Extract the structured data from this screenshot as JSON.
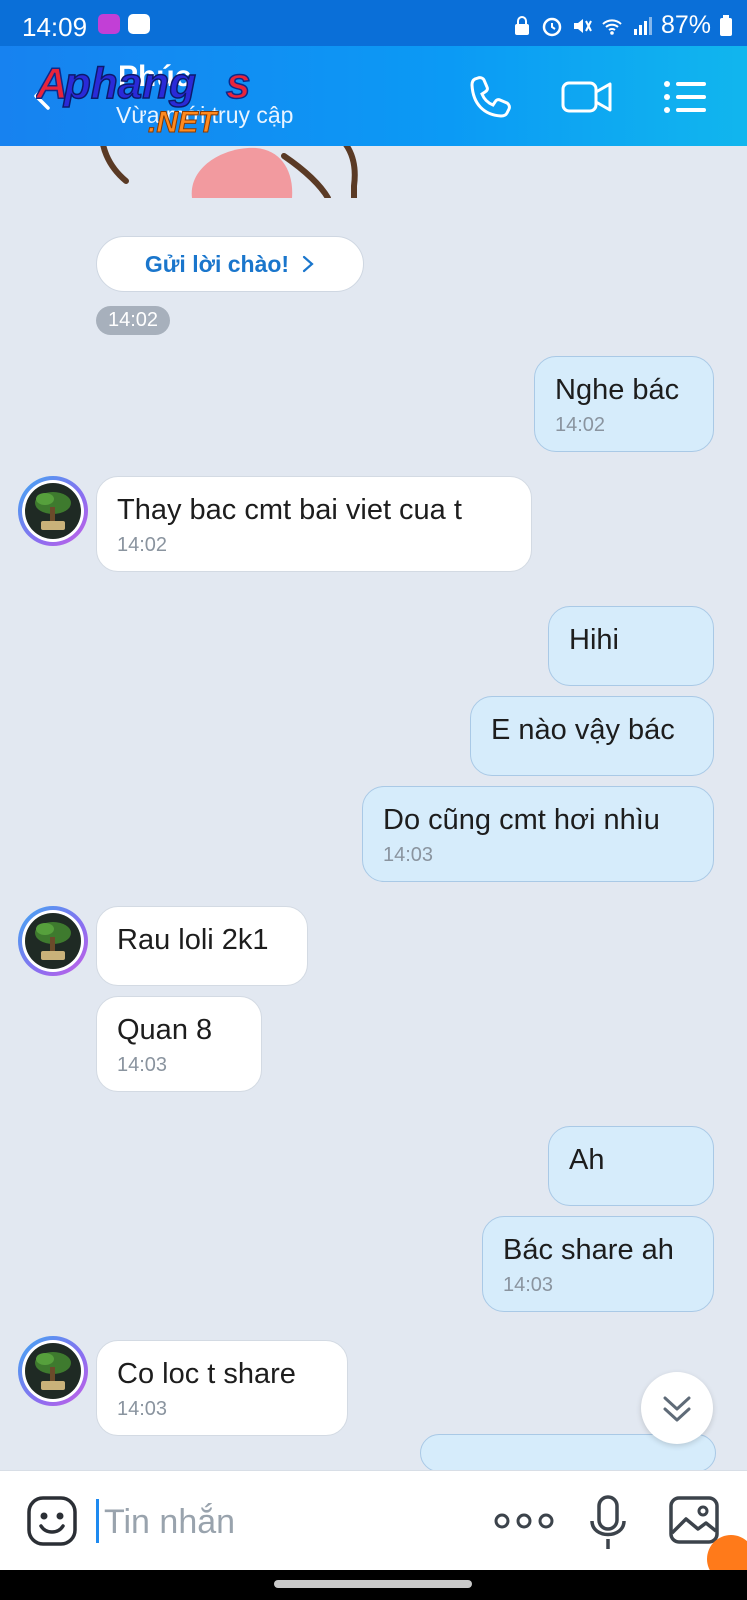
{
  "status_bar": {
    "time": "14:09",
    "battery": "87%"
  },
  "header": {
    "contact_name": "Phúc",
    "status": "Vừa mới truy cập",
    "watermark": "Aphangs .NET"
  },
  "chat": {
    "greeting_button": "Gửi lời chào!",
    "sticker_time": "14:02",
    "messages": [
      {
        "from": "me",
        "text": "Nghe bác",
        "time": "14:02"
      },
      {
        "from": "them",
        "text": "Thay bac cmt bai viet cua t",
        "time": "14:02"
      },
      {
        "from": "me",
        "text": "Hihi",
        "time": ""
      },
      {
        "from": "me",
        "text": "E nào vậy bác",
        "time": ""
      },
      {
        "from": "me",
        "text": "Do cũng cmt hơi nhìu",
        "time": "14:03"
      },
      {
        "from": "them",
        "text": "Rau loli 2k1",
        "time": ""
      },
      {
        "from": "them",
        "text": "Quan 8",
        "time": "14:03"
      },
      {
        "from": "me",
        "text": "Ah",
        "time": ""
      },
      {
        "from": "me",
        "text": "Bác share ah",
        "time": "14:03"
      },
      {
        "from": "them",
        "text": "Co loc t share",
        "time": "14:03"
      }
    ]
  },
  "composer": {
    "placeholder": "Tin nhắn"
  },
  "colors": {
    "header_start": "#1782f0",
    "header_end": "#11b6ee",
    "my_bubble": "#d6ecfb",
    "their_bubble": "#ffffff",
    "chat_bg": "#e2e8f1"
  },
  "icons": [
    "back-icon",
    "phone-icon",
    "video-call-icon",
    "menu-list-icon",
    "chevron-right-icon",
    "emoji-icon",
    "more-dots-icon",
    "microphone-icon",
    "image-icon",
    "scroll-down-icon"
  ]
}
